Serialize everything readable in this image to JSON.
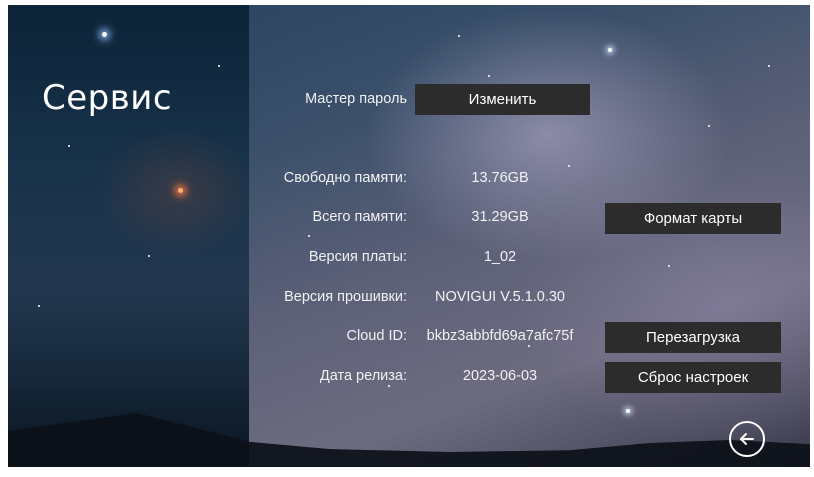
{
  "page": {
    "title": "Сервис"
  },
  "master_password": {
    "label": "Мастер пароль",
    "button": "Изменить"
  },
  "info": {
    "free_memory": {
      "label": "Свободно памяти:",
      "value": "13.76GB"
    },
    "total_memory": {
      "label": "Всего памяти:",
      "value": "31.29GB"
    },
    "board_version": {
      "label": "Версия платы:",
      "value": "1_02"
    },
    "firmware_version": {
      "label": "Версия прошивки:",
      "value": "NOVIGUI V.5.1.0.30"
    },
    "cloud_id": {
      "label": "Cloud ID:",
      "value": "bkbz3abbfd69a7afc75f"
    },
    "release_date": {
      "label": "Дата релиза:",
      "value": "2023-06-03"
    }
  },
  "actions": {
    "format_card": "Формат карты",
    "reboot": "Перезагрузка",
    "reset_settings": "Сброс настроек"
  },
  "icons": {
    "back": "back-arrow-icon"
  },
  "colors": {
    "button_bg": "#2c2c2c",
    "text": "#ffffff"
  }
}
